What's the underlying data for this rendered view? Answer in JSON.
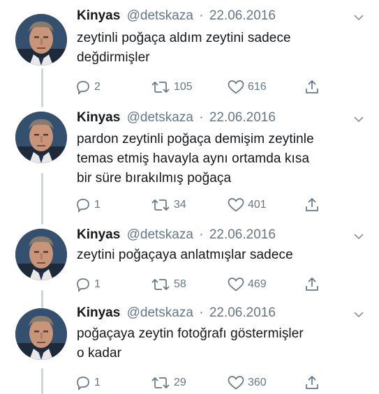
{
  "tweets": [
    {
      "name": "Kinyas",
      "handle": "@detskaza",
      "separator": "·",
      "date": "22.06.2016",
      "lines": [
        "zeytinli poğaça aldım zeytini sadece",
        "değdirmişler"
      ],
      "replies": "2",
      "retweets": "105",
      "likes": "616"
    },
    {
      "name": "Kinyas",
      "handle": "@detskaza",
      "separator": "·",
      "date": "22.06.2016",
      "lines": [
        "pardon zeytinli poğaça demişim zeytinle",
        "temas etmiş havayla aynı ortamda kısa",
        "bir süre bırakılmış poğaça"
      ],
      "replies": "1",
      "retweets": "34",
      "likes": "401"
    },
    {
      "name": "Kinyas",
      "handle": "@detskaza",
      "separator": "·",
      "date": "22.06.2016",
      "lines": [
        "zeytini poğaçaya anlatmışlar sadece"
      ],
      "replies": "1",
      "retweets": "58",
      "likes": "469"
    },
    {
      "name": "Kinyas",
      "handle": "@detskaza",
      "separator": "·",
      "date": "22.06.2016",
      "lines": [
        "poğaçaya zeytin fotoğrafı göstermişler",
        "o kadar"
      ],
      "replies": "1",
      "retweets": "29",
      "likes": "360"
    }
  ],
  "icons": {
    "reply": "reply-icon",
    "retweet": "retweet-icon",
    "like": "heart-icon",
    "share": "share-icon",
    "more": "chevron-down-icon",
    "avatar": "avatar"
  },
  "colors": {
    "text": "#14171a",
    "secondary": "#657786",
    "thread_line": "#ccd6dd"
  }
}
